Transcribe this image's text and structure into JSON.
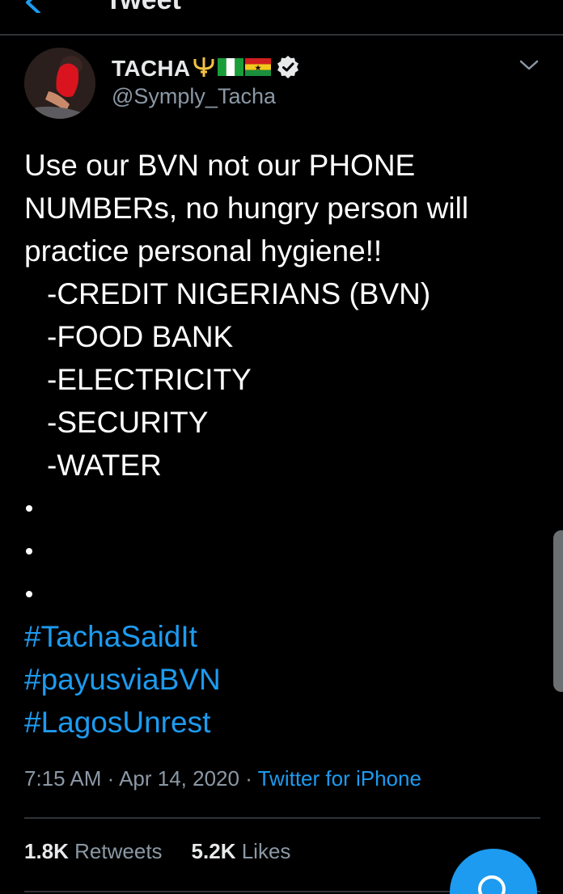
{
  "header": {
    "title": "Tweet"
  },
  "author": {
    "name": "TACHA",
    "handle": "@Symply_Tacha",
    "emojis": [
      "trident",
      "flag-nigeria",
      "flag-ghana"
    ],
    "verified": true
  },
  "tweet": {
    "lines": [
      "Use our BVN not our PHONE",
      "NUMBERs, no hungry person will",
      "practice personal hygiene!!",
      "-CREDIT NIGERIANS (BVN)",
      "-FOOD BANK",
      "-ELECTRICITY",
      "-SECURITY",
      "-WATER"
    ],
    "bullets": 3,
    "hashtags": [
      "#TachaSaidIt",
      "#payusviaBVN",
      "#LagosUnrest"
    ]
  },
  "meta": {
    "time": "7:15 AM",
    "separator": " · ",
    "date": "Apr 14, 2020",
    "source": "Twitter for iPhone"
  },
  "stats": {
    "retweets_count": "1.8K",
    "retweets_label": "Retweets",
    "likes_count": "5.2K",
    "likes_label": "Likes"
  },
  "colors": {
    "background": "#000000",
    "accent": "#1d9bf0",
    "secondary_text": "#8b98a5",
    "divider": "#2f3336"
  },
  "icons": {
    "back": "arrow-left-icon",
    "caret": "chevron-down-icon",
    "verified": "verified-badge-icon",
    "compose": "compose-icon"
  }
}
